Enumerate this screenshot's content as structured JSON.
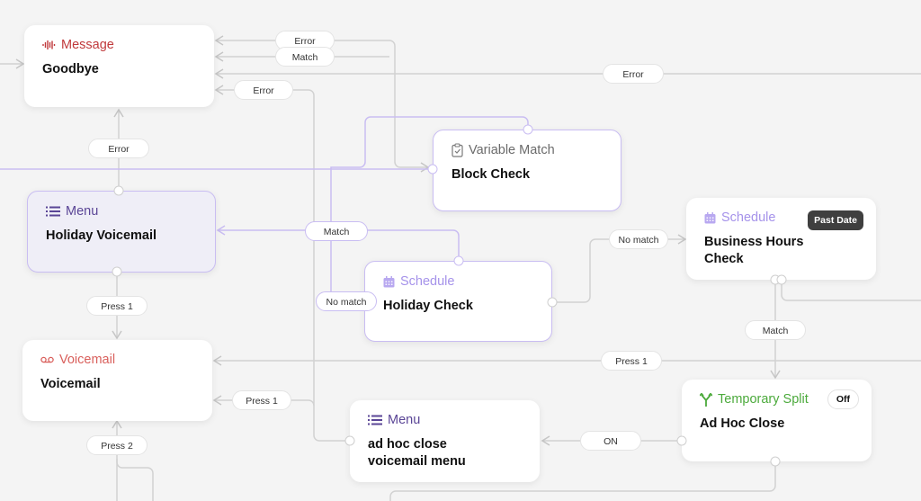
{
  "colors": {
    "canvas": "#f4f4f4",
    "edge_gray": "#cfcfcf",
    "edge_purple": "#c9bdf2",
    "message": "#c0393b",
    "menu": "#5a4596",
    "schedule": "#a592ea",
    "voicemail": "#d9605c",
    "split": "#4caa3c",
    "variable": "#6b6b6b"
  },
  "nodes": {
    "goodbye": {
      "type_icon": "waveform-icon",
      "type_label": "Message",
      "title": "Goodbye"
    },
    "block_check": {
      "type_icon": "clipboard-check-icon",
      "type_label": "Variable Match",
      "title": "Block Check"
    },
    "holiday_voicemail": {
      "type_icon": "list-icon",
      "type_label": "Menu",
      "title": "Holiday Voicemail",
      "selected": true
    },
    "holiday_check": {
      "type_icon": "calendar-icon",
      "type_label": "Schedule",
      "title": "Holiday Check"
    },
    "business_hours": {
      "type_icon": "calendar-icon",
      "type_label": "Schedule",
      "title": "Business Hours Check",
      "badge": "Past Date"
    },
    "voicemail": {
      "type_icon": "voicemail-icon",
      "type_label": "Voicemail",
      "title": "Voicemail"
    },
    "adhoc_menu": {
      "type_icon": "list-icon",
      "type_label": "Menu",
      "title": "ad hoc close voicemail menu"
    },
    "adhoc_close": {
      "type_icon": "split-icon",
      "type_label": "Temporary Split",
      "title": "Ad Hoc Close",
      "badge": "Off"
    }
  },
  "edge_labels": {
    "error_top": "Error",
    "match_top": "Match",
    "error_mid": "Error",
    "error_right": "Error",
    "error_goodbye_below": "Error",
    "match_holiday": "Match",
    "no_match_holiday": "No match",
    "no_match_business": "No match",
    "press1_holiday": "Press 1",
    "match_business": "Match",
    "press1_right": "Press 1",
    "press1_adhoc": "Press 1",
    "on_adhoc": "ON",
    "press2": "Press 2"
  }
}
